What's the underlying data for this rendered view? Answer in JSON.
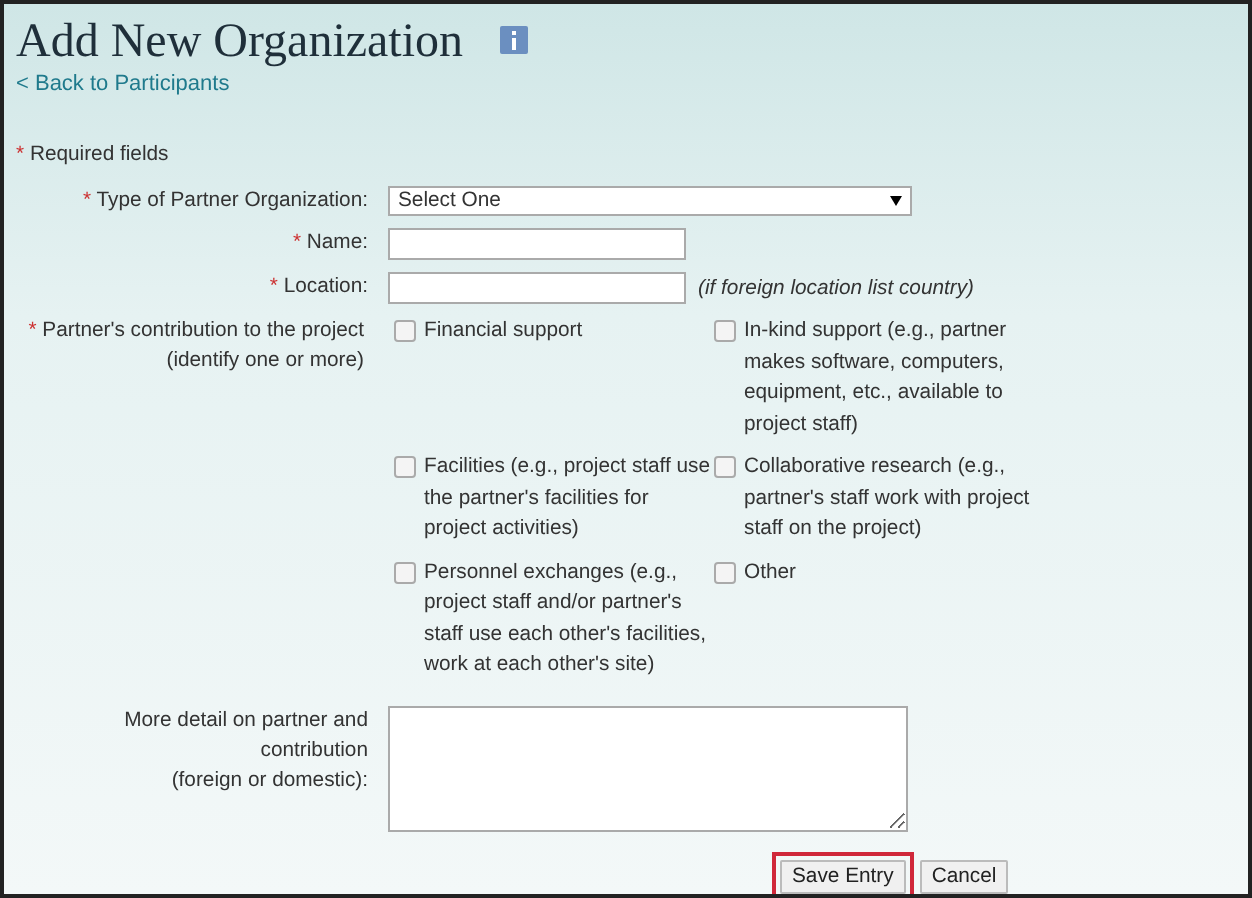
{
  "title": "Add New Organization",
  "back_link": "< Back to Participants",
  "required_note": {
    "mark": "*",
    "text": "Required fields"
  },
  "fields": [
    {
      "kind": "select",
      "required": true,
      "label": "Type of Partner Organization:",
      "value": "Select One"
    },
    {
      "kind": "text",
      "required": true,
      "label": "Name:"
    },
    {
      "kind": "text",
      "required": true,
      "label": "Location:",
      "hint": "(if foreign location list country)"
    }
  ],
  "contribution": {
    "required": true,
    "label": "Partner's contribution to the project",
    "sublabel": "(identify one or more)",
    "options": [
      {
        "label": "Financial support",
        "checked": false
      },
      {
        "label": "In-kind support (e.g., partner makes software, computers, equipment, etc., available to project staff)",
        "checked": false
      },
      {
        "label": "Facilities (e.g., project staff use the partner's facilities for project activities)",
        "checked": false
      },
      {
        "label": "Collaborative research (e.g., partner's staff work with project staff on the project)",
        "checked": false
      },
      {
        "label": "Personnel exchanges (e.g., project staff and/or partner's staff use each other's facilities, work at each other's site)",
        "checked": false
      },
      {
        "label": "Other",
        "checked": false
      }
    ]
  },
  "detail": {
    "label_lines": [
      "More detail on partner and",
      "contribution",
      "(foreign or domestic):"
    ]
  },
  "buttons": [
    {
      "label": "Save Entry",
      "highlighted": true
    },
    {
      "label": "Cancel",
      "highlighted": false
    }
  ]
}
